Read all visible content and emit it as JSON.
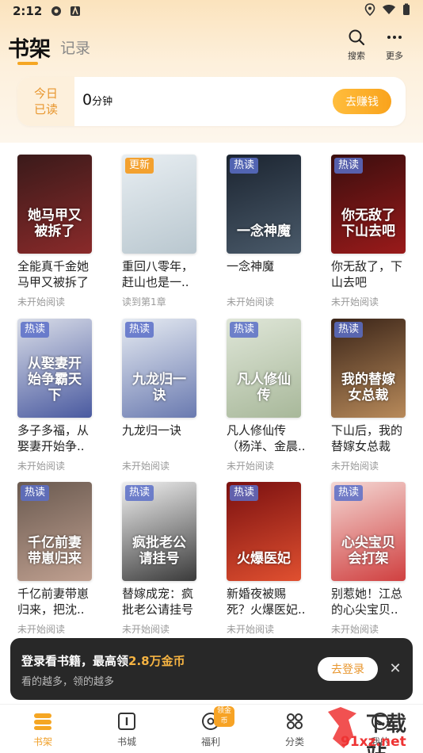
{
  "status_bar": {
    "time": "2:12"
  },
  "header": {
    "tab_active": "书架",
    "tab_inactive": "记录",
    "search_label": "搜索",
    "more_label": "更多"
  },
  "today": {
    "label_line1": "今日",
    "label_line2": "已读",
    "value": "0",
    "unit": "分钟",
    "button": "去赚钱"
  },
  "books": [
    {
      "title": "全能真千金她马甲又被拆了",
      "title_display": "全能真千金她马甲又被拆了",
      "status": "未开始阅读",
      "badge": "",
      "cover_text": "她马甲又被拆了",
      "colors": [
        "#3a1a1a",
        "#8a2a2a"
      ]
    },
    {
      "title": "重回八零年，赶山也是一..",
      "title_display": "重回八零年，赶山也是一..",
      "status": "读到第1章",
      "badge": "更新",
      "cover_text": "",
      "colors": [
        "#e8eef2",
        "#b9c7cf"
      ]
    },
    {
      "title": "一念神魔",
      "title_display": "一念神魔",
      "status": "未开始阅读",
      "badge": "热读",
      "cover_text": "一念神魔",
      "colors": [
        "#1b2430",
        "#4a5a6a"
      ]
    },
    {
      "title": "你无敌了，下山去吧",
      "title_display": "你无敌了，下山去吧",
      "status": "未开始阅读",
      "badge": "热读",
      "cover_text": "你无敌了下山去吧",
      "colors": [
        "#3a0e0e",
        "#9a1a1a"
      ]
    },
    {
      "title": "多子多福，从娶妻开始争..",
      "title_display": "多子多福，从娶妻开始争..",
      "status": "未开始阅读",
      "badge": "热读",
      "cover_text": "从娶妻开始争霸天下",
      "colors": [
        "#d9dde8",
        "#4a5aa0"
      ]
    },
    {
      "title": "九龙归一诀",
      "title_display": "九龙归一诀",
      "status": "未开始阅读",
      "badge": "热读",
      "cover_text": "九龙归一诀",
      "colors": [
        "#e6ebf2",
        "#6a7ab0"
      ]
    },
    {
      "title": "凡人修仙传（杨洋、金晨..",
      "title_display": "凡人修仙传（杨洋、金晨..",
      "status": "未开始阅读",
      "badge": "热读",
      "cover_text": "凡人修仙传",
      "colors": [
        "#dfe6d8",
        "#a8b89a"
      ]
    },
    {
      "title": "下山后，我的替嫁女总裁",
      "title_display": "下山后，我的替嫁女总裁",
      "status": "未开始阅读",
      "badge": "热读",
      "cover_text": "我的替嫁女总裁",
      "colors": [
        "#3a2418",
        "#b88a5a"
      ]
    },
    {
      "title": "千亿前妻带崽归来，把沈..",
      "title_display": "千亿前妻带崽归来，把沈..",
      "status": "未开始阅读",
      "badge": "热读",
      "cover_text": "千亿前妻带崽归来",
      "colors": [
        "#6a5a50",
        "#c0a090"
      ]
    },
    {
      "title": "替嫁成宠：疯批老公请挂号",
      "title_display": "替嫁成宠：疯批老公请挂号",
      "status": "未开始阅读",
      "badge": "热读",
      "cover_text": "疯批老公请挂号",
      "colors": [
        "#f0f0f0",
        "#3a3a3a"
      ]
    },
    {
      "title": "新婚夜被赐死？火爆医妃..",
      "title_display": "新婚夜被赐死？火爆医妃..",
      "status": "未开始阅读",
      "badge": "热读",
      "cover_text": "火爆医妃",
      "colors": [
        "#7a1010",
        "#e05030"
      ]
    },
    {
      "title": "别惹她！江总的心尖宝贝..",
      "title_display": "别惹她！江总的心尖宝贝..",
      "status": "未开始阅读",
      "badge": "热读",
      "cover_text": "心尖宝贝会打架",
      "colors": [
        "#f4d8d4",
        "#d04040"
      ]
    }
  ],
  "login_bar": {
    "title_prefix": "登录看书籍，最高领",
    "title_highlight": "2.8万金币",
    "subtitle": "看的越多，领的越多",
    "button": "去登录"
  },
  "tabbar": {
    "items": [
      {
        "label": "书架",
        "icon": "bookshelf-icon"
      },
      {
        "label": "书城",
        "icon": "book-open-icon"
      },
      {
        "label": "福利",
        "icon": "coin-icon"
      },
      {
        "label": "分类",
        "icon": "grid-icon"
      },
      {
        "label": "我的",
        "icon": "profile-icon"
      }
    ],
    "badge": "领金币"
  },
  "watermark": {
    "text": "下载站",
    "url": "91xz.net"
  },
  "colors": {
    "accent": "#f5a623",
    "status_text": "#999999"
  }
}
